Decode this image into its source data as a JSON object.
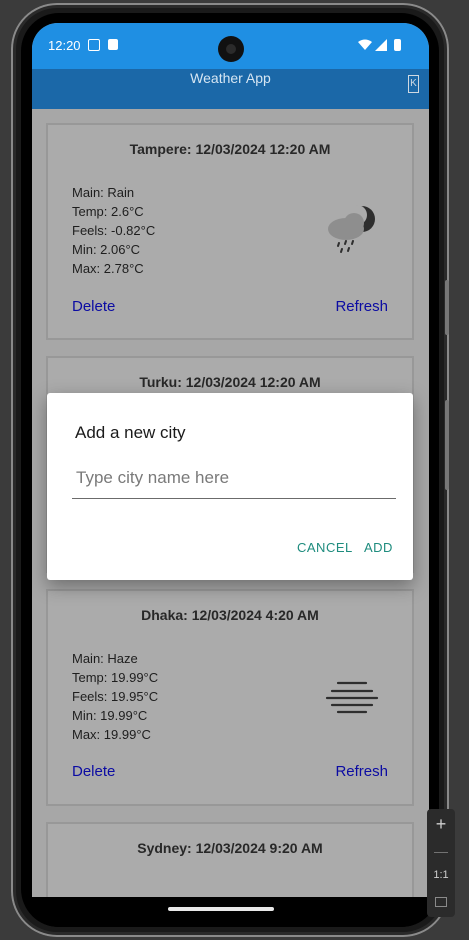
{
  "status_bar": {
    "time": "12:20"
  },
  "app_bar": {
    "title": "Weather App",
    "icon": "exit-icon"
  },
  "cards": [
    {
      "title": "Tampere: 12/03/2024 12:20 AM",
      "lines": [
        "Main: Rain",
        "Temp: 2.6°C",
        "Feels: -0.82°C",
        "Min: 2.06°C",
        "Max: 2.78°C"
      ],
      "icon": "rain-cloud-moon-icon",
      "delete_label": "Delete",
      "refresh_label": "Refresh"
    },
    {
      "title": "Turku: 12/03/2024 12:20 AM"
    },
    {
      "title": "Dhaka: 12/03/2024 4:20 AM",
      "lines": [
        "Main: Haze",
        "Temp: 19.99°C",
        "Feels: 19.95°C",
        "Min: 19.99°C",
        "Max: 19.99°C"
      ],
      "icon": "haze-icon",
      "delete_label": "Delete",
      "refresh_label": "Refresh"
    },
    {
      "title": "Sydney: 12/03/2024 9:20 AM"
    }
  ],
  "dialog": {
    "title": "Add a new city",
    "input_placeholder": "Type city name here",
    "input_value": "",
    "cancel_label": "CANCEL",
    "add_label": "ADD"
  },
  "emulator_toolbar": {
    "zoom_in": "+",
    "zoom_out": "—",
    "actual_size": "1:1"
  }
}
